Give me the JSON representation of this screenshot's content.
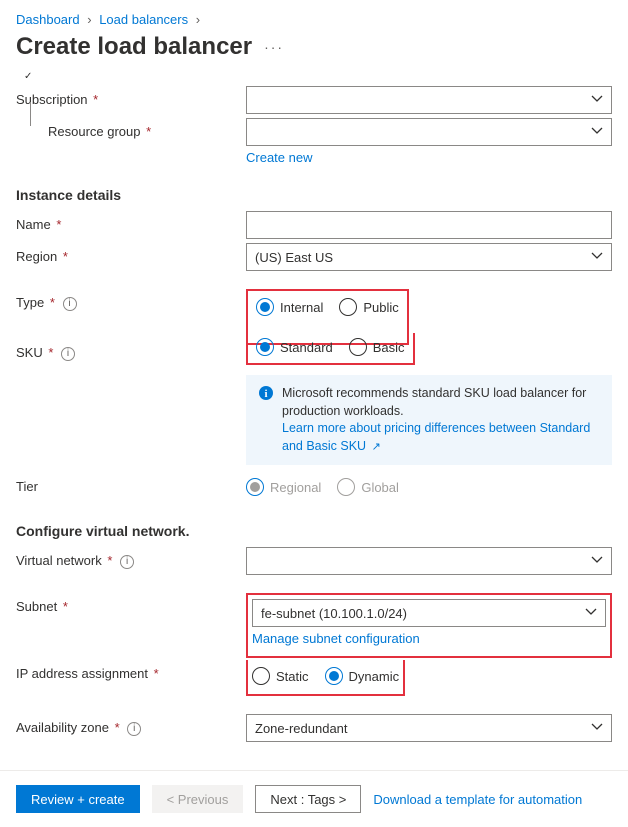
{
  "breadcrumb": {
    "a": "Dashboard",
    "b": "Load balancers"
  },
  "page_title": "Create load balancer",
  "labels": {
    "subscription": "Subscription",
    "resource_group": "Resource group",
    "create_new": "Create new",
    "instance_details": "Instance details",
    "name": "Name",
    "region": "Region",
    "type": "Type",
    "sku": "SKU",
    "tier": "Tier",
    "configure_vnet": "Configure virtual network.",
    "virtual_network": "Virtual network",
    "subnet": "Subnet",
    "manage_subnet": "Manage subnet configuration",
    "ip_assignment": "IP address assignment",
    "az": "Availability zone"
  },
  "values": {
    "subscription": "",
    "resource_group": "",
    "name": "",
    "region": "(US) East US",
    "vnet": "",
    "subnet": "fe-subnet (10.100.1.0/24)",
    "az": "Zone-redundant"
  },
  "radios": {
    "type": {
      "a": "Internal",
      "b": "Public",
      "selected": "Internal"
    },
    "sku": {
      "a": "Standard",
      "b": "Basic",
      "selected": "Standard"
    },
    "tier": {
      "a": "Regional",
      "b": "Global"
    },
    "ip": {
      "a": "Static",
      "b": "Dynamic",
      "selected": "Dynamic"
    }
  },
  "callout": {
    "text": "Microsoft recommends standard SKU load balancer for production workloads.",
    "link": "Learn more about pricing differences between Standard and Basic SKU"
  },
  "footer": {
    "review": "Review + create",
    "prev": "< Previous",
    "next": "Next : Tags >",
    "download": "Download a template for automation"
  }
}
